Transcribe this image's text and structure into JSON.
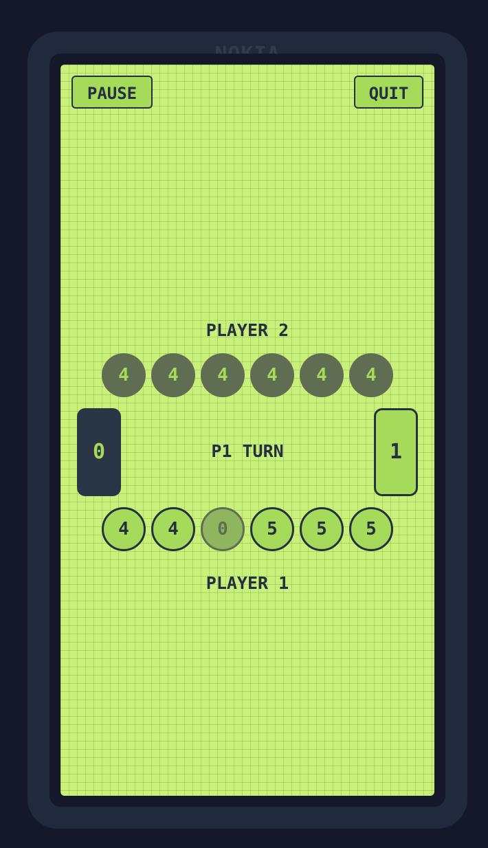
{
  "device": {
    "brand": "NOKIA"
  },
  "controls": {
    "pause_label": "PAUSE",
    "quit_label": "QUIT"
  },
  "player2": {
    "label": "PLAYER 2",
    "store": "0",
    "pits": [
      "4",
      "4",
      "4",
      "4",
      "4",
      "4"
    ]
  },
  "player1": {
    "label": "PLAYER 1",
    "store": "1",
    "pits": [
      "4",
      "4",
      "0",
      "5",
      "5",
      "5"
    ]
  },
  "status": {
    "turn": "P1 TURN"
  },
  "colors": {
    "screen": "#c9f07a",
    "ink": "#243040",
    "pit_light": "#a5da5b",
    "pit_opponent": "#5f6e53",
    "body": "#212a3c"
  }
}
